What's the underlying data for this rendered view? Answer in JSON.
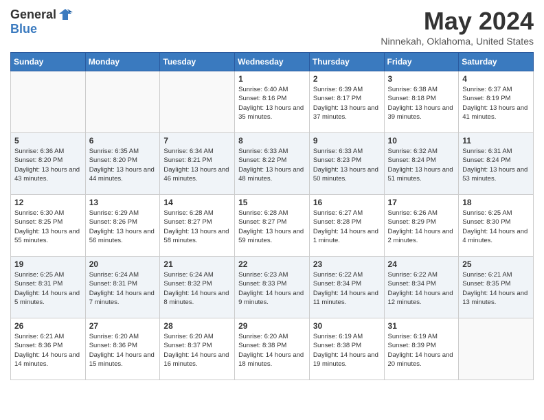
{
  "header": {
    "logo_general": "General",
    "logo_blue": "Blue",
    "title": "May 2024",
    "location": "Ninnekah, Oklahoma, United States"
  },
  "days_of_week": [
    "Sunday",
    "Monday",
    "Tuesday",
    "Wednesday",
    "Thursday",
    "Friday",
    "Saturday"
  ],
  "weeks": [
    [
      {
        "day": "",
        "info": ""
      },
      {
        "day": "",
        "info": ""
      },
      {
        "day": "",
        "info": ""
      },
      {
        "day": "1",
        "info": "Sunrise: 6:40 AM\nSunset: 8:16 PM\nDaylight: 13 hours\nand 35 minutes."
      },
      {
        "day": "2",
        "info": "Sunrise: 6:39 AM\nSunset: 8:17 PM\nDaylight: 13 hours\nand 37 minutes."
      },
      {
        "day": "3",
        "info": "Sunrise: 6:38 AM\nSunset: 8:18 PM\nDaylight: 13 hours\nand 39 minutes."
      },
      {
        "day": "4",
        "info": "Sunrise: 6:37 AM\nSunset: 8:19 PM\nDaylight: 13 hours\nand 41 minutes."
      }
    ],
    [
      {
        "day": "5",
        "info": "Sunrise: 6:36 AM\nSunset: 8:20 PM\nDaylight: 13 hours\nand 43 minutes."
      },
      {
        "day": "6",
        "info": "Sunrise: 6:35 AM\nSunset: 8:20 PM\nDaylight: 13 hours\nand 44 minutes."
      },
      {
        "day": "7",
        "info": "Sunrise: 6:34 AM\nSunset: 8:21 PM\nDaylight: 13 hours\nand 46 minutes."
      },
      {
        "day": "8",
        "info": "Sunrise: 6:33 AM\nSunset: 8:22 PM\nDaylight: 13 hours\nand 48 minutes."
      },
      {
        "day": "9",
        "info": "Sunrise: 6:33 AM\nSunset: 8:23 PM\nDaylight: 13 hours\nand 50 minutes."
      },
      {
        "day": "10",
        "info": "Sunrise: 6:32 AM\nSunset: 8:24 PM\nDaylight: 13 hours\nand 51 minutes."
      },
      {
        "day": "11",
        "info": "Sunrise: 6:31 AM\nSunset: 8:24 PM\nDaylight: 13 hours\nand 53 minutes."
      }
    ],
    [
      {
        "day": "12",
        "info": "Sunrise: 6:30 AM\nSunset: 8:25 PM\nDaylight: 13 hours\nand 55 minutes."
      },
      {
        "day": "13",
        "info": "Sunrise: 6:29 AM\nSunset: 8:26 PM\nDaylight: 13 hours\nand 56 minutes."
      },
      {
        "day": "14",
        "info": "Sunrise: 6:28 AM\nSunset: 8:27 PM\nDaylight: 13 hours\nand 58 minutes."
      },
      {
        "day": "15",
        "info": "Sunrise: 6:28 AM\nSunset: 8:27 PM\nDaylight: 13 hours\nand 59 minutes."
      },
      {
        "day": "16",
        "info": "Sunrise: 6:27 AM\nSunset: 8:28 PM\nDaylight: 14 hours\nand 1 minute."
      },
      {
        "day": "17",
        "info": "Sunrise: 6:26 AM\nSunset: 8:29 PM\nDaylight: 14 hours\nand 2 minutes."
      },
      {
        "day": "18",
        "info": "Sunrise: 6:25 AM\nSunset: 8:30 PM\nDaylight: 14 hours\nand 4 minutes."
      }
    ],
    [
      {
        "day": "19",
        "info": "Sunrise: 6:25 AM\nSunset: 8:31 PM\nDaylight: 14 hours\nand 5 minutes."
      },
      {
        "day": "20",
        "info": "Sunrise: 6:24 AM\nSunset: 8:31 PM\nDaylight: 14 hours\nand 7 minutes."
      },
      {
        "day": "21",
        "info": "Sunrise: 6:24 AM\nSunset: 8:32 PM\nDaylight: 14 hours\nand 8 minutes."
      },
      {
        "day": "22",
        "info": "Sunrise: 6:23 AM\nSunset: 8:33 PM\nDaylight: 14 hours\nand 9 minutes."
      },
      {
        "day": "23",
        "info": "Sunrise: 6:22 AM\nSunset: 8:34 PM\nDaylight: 14 hours\nand 11 minutes."
      },
      {
        "day": "24",
        "info": "Sunrise: 6:22 AM\nSunset: 8:34 PM\nDaylight: 14 hours\nand 12 minutes."
      },
      {
        "day": "25",
        "info": "Sunrise: 6:21 AM\nSunset: 8:35 PM\nDaylight: 14 hours\nand 13 minutes."
      }
    ],
    [
      {
        "day": "26",
        "info": "Sunrise: 6:21 AM\nSunset: 8:36 PM\nDaylight: 14 hours\nand 14 minutes."
      },
      {
        "day": "27",
        "info": "Sunrise: 6:20 AM\nSunset: 8:36 PM\nDaylight: 14 hours\nand 15 minutes."
      },
      {
        "day": "28",
        "info": "Sunrise: 6:20 AM\nSunset: 8:37 PM\nDaylight: 14 hours\nand 16 minutes."
      },
      {
        "day": "29",
        "info": "Sunrise: 6:20 AM\nSunset: 8:38 PM\nDaylight: 14 hours\nand 18 minutes."
      },
      {
        "day": "30",
        "info": "Sunrise: 6:19 AM\nSunset: 8:38 PM\nDaylight: 14 hours\nand 19 minutes."
      },
      {
        "day": "31",
        "info": "Sunrise: 6:19 AM\nSunset: 8:39 PM\nDaylight: 14 hours\nand 20 minutes."
      },
      {
        "day": "",
        "info": ""
      }
    ]
  ]
}
